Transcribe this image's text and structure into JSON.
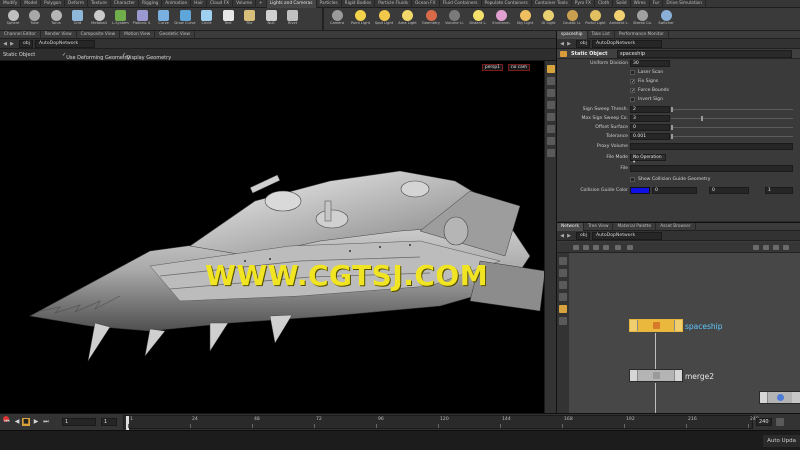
{
  "shelf_tabs": [
    "Modify",
    "Model",
    "Polygon",
    "Deform",
    "Texture",
    "Character",
    "Rigging",
    "Animation",
    "Hair",
    "Cloud FX",
    "Volume",
    "+",
    "Lights and Cameras",
    "Particles",
    "Rigid Bodies",
    "Particle Fluids",
    "Ocean FX",
    "Fluid Containers",
    "Populate Containers",
    "Container Tools",
    "Pyro FX",
    "Cloth",
    "Solid",
    "Wires",
    "Fur",
    "Drive Simulation"
  ],
  "shelf_tools_left": [
    "Sphere",
    "Tube",
    "Torus",
    "Grid",
    "Metaball",
    "L-System",
    "Platonic S.",
    "Curve",
    "Draw Curve",
    "Circle",
    "Text",
    "File",
    "Null",
    "Rivet"
  ],
  "shelf_tools_right": [
    "Camera",
    "Point Light",
    "Spot Light",
    "Area Light",
    "Geometry",
    "Volume Li.",
    "Distant L.",
    "Environm.",
    "Sky Light",
    "GI Light",
    "Caustic Li.",
    "Portal Light",
    "Ambient L.",
    "Stereo Ca.",
    "Switcher"
  ],
  "left_tabs": [
    "Channel Editor",
    "Render View",
    "Composite View",
    "Motion View",
    "Geodetic View"
  ],
  "left_path": "AutoDopNetwork",
  "path_obj": "obj",
  "viewport_bar": {
    "mode": "Static Object",
    "use_deforming": "Use Deforming Geometry",
    "display_geometry": "Display Geometry"
  },
  "camera_menu": {
    "view": "persp1",
    "camera": "no cam"
  },
  "watermark": "WWW.CGTSJ.COM",
  "right_top_tabs": [
    "spaceship",
    "Take List",
    "Performance Monitor"
  ],
  "right_top_path": "AutoDopNetwork",
  "param_header": {
    "title": "Static Object",
    "name": "spaceship"
  },
  "params": {
    "division_size": {
      "label": "Uniform Division",
      "value": "30"
    },
    "laser_scan": {
      "label": "Laser Scan",
      "checked": false
    },
    "fix_signs": {
      "label": "Fix Signs",
      "checked": true
    },
    "force_bounds": {
      "label": "Force Bounds",
      "checked": true
    },
    "invert_sign": {
      "label": "Invert Sign",
      "checked": false
    },
    "sign_sweep_threshold": {
      "label": "Sign Sweep Thresh.",
      "value": "2"
    },
    "max_sign_sweep": {
      "label": "Max Sign Sweep Co.",
      "value": "3"
    },
    "offset_surface": {
      "label": "Offset Surface",
      "value": "0"
    },
    "tolerance": {
      "label": "Tolerance",
      "value": "0.001"
    },
    "proxy_volume": {
      "label": "Proxy Volume"
    },
    "file_mode": {
      "label": "File Mode",
      "value": "No Operation"
    },
    "file": {
      "label": "File"
    },
    "show_collision_guide": {
      "label": "Show Collision Guide Geometry",
      "checked": false
    },
    "collision_guide_color": {
      "label": "Collision Guide Color",
      "r": "0",
      "g": "0",
      "b": "1",
      "color": "#1010e6"
    }
  },
  "right_bottom_tabs": [
    "Network",
    "Tree View",
    "Material Palette",
    "Asset Browser"
  ],
  "right_bottom_path": "AutoDopNetwork",
  "nodes": {
    "spaceship": "spaceship",
    "merge": "merge2"
  },
  "timeline": {
    "start_frame": "1",
    "current_frame": "1",
    "end_frame": "240",
    "tick_labels": [
      "1",
      "24",
      "48",
      "72",
      "96",
      "120",
      "144",
      "168",
      "192",
      "216",
      "240"
    ]
  },
  "taskbar": {
    "auto_update": "Auto Upda"
  },
  "colors": {
    "accent_node": "#e8c159",
    "node_label": "#5fc8ff",
    "watermark": "#f1e423"
  }
}
